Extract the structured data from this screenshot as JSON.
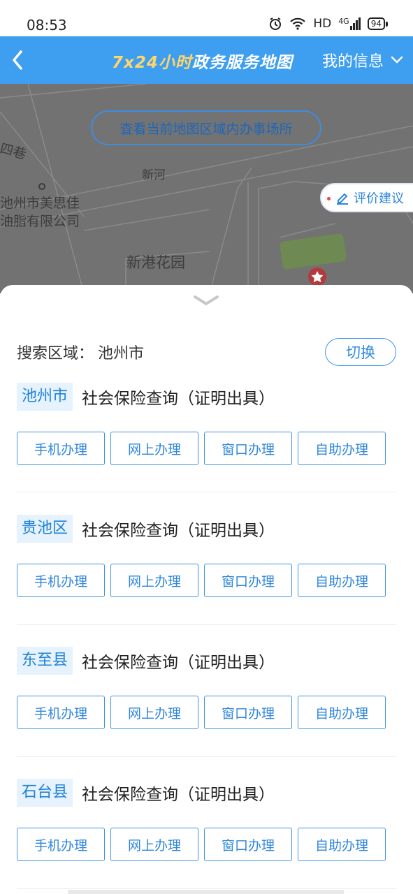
{
  "status_bar": {
    "time": "08:53",
    "network_label": "HD",
    "signal_label": "4G",
    "battery": "94"
  },
  "nav": {
    "title_accent": "7x24小时",
    "title_main": "政务服务地图",
    "my_info": "我的信息"
  },
  "map": {
    "search_area_button": "查看当前地图区域内办事场所",
    "feedback_button": "评价建议",
    "labels": {
      "lane": "四巷",
      "xinhe": "新河",
      "company_line1": "池州市美思佳",
      "company_line2": "油脂有限公司",
      "xingang": "新港花园"
    }
  },
  "search": {
    "label": "搜索区域：",
    "value": "池州市",
    "switch_button": "切换"
  },
  "services": [
    {
      "region": "池州市",
      "title": "社会保险查询（证明出具）",
      "methods": [
        "手机办理",
        "网上办理",
        "窗口办理",
        "自助办理"
      ]
    },
    {
      "region": "贵池区",
      "title": "社会保险查询（证明出具）",
      "methods": [
        "手机办理",
        "网上办理",
        "窗口办理",
        "自助办理"
      ]
    },
    {
      "region": "东至县",
      "title": "社会保险查询（证明出具）",
      "methods": [
        "手机办理",
        "网上办理",
        "窗口办理",
        "自助办理"
      ]
    },
    {
      "region": "石台县",
      "title": "社会保险查询（证明出具）",
      "methods": [
        "手机办理",
        "网上办理",
        "窗口办理",
        "自助办理"
      ]
    }
  ],
  "colors": {
    "primary": "#3e9ef0",
    "accent": "#ffd66b",
    "tag_bg": "#e6f2fd",
    "map_bg": "#727272"
  }
}
